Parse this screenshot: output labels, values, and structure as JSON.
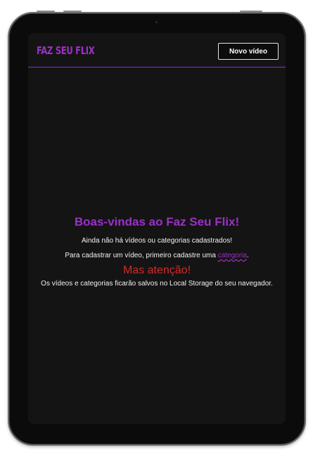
{
  "header": {
    "logo": "FAZ SEU FLIX",
    "new_video_button": "Novo vídeo"
  },
  "welcome": {
    "title": "Boas-vindas ao Faz Seu Flix!",
    "no_content": "Ainda não há vídeos ou categorias cadastrados!",
    "register_prefix": "Para cadastrar um vídeo, primeiro cadastre uma ",
    "category_link": "categoria",
    "register_suffix": ".",
    "warning": "Mas atenção!",
    "storage_note": "Os vídeos e categorias ficarão salvos no Local Storage do seu navegador."
  },
  "colors": {
    "brand": "#9b30c8",
    "warning": "#d22a2a",
    "background": "#141414",
    "divider": "#8a2be2"
  }
}
